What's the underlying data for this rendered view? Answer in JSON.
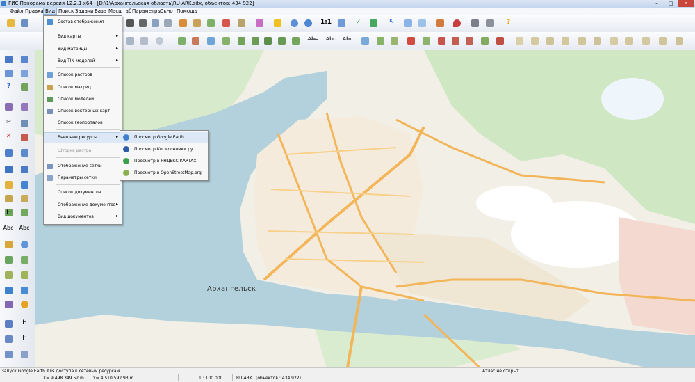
{
  "window": {
    "title": "ГИС Панорама версия 12.2.1 x64 - [D:\\1\\Архангельская область\\RU-ARK.sitx, объектов: 434 922]",
    "controls": [
      "–",
      "□",
      "✕"
    ]
  },
  "menubar": {
    "items": [
      "Файл",
      "Правка",
      "Вид",
      "Поиск",
      "Задачи",
      "База",
      "Масштаб",
      "Параметры",
      "Окно",
      "Помощь"
    ]
  },
  "toolbar": {
    "scale_button": "1:1",
    "labels": [
      "Abc",
      "Abc",
      "Abc"
    ]
  },
  "left_toolbar": {
    "labels": [
      "Abc",
      "Abc",
      "H",
      "H",
      "H"
    ]
  },
  "view_menu": {
    "items": [
      {
        "label": "Состав отображения",
        "arrow": "",
        "disabled": false
      },
      {
        "label": "Вид карты",
        "arrow": "▸",
        "disabled": false
      },
      {
        "label": "Вид матрицы",
        "arrow": "▸",
        "disabled": false
      },
      {
        "label": "Вид TIN-моделей",
        "arrow": "▸",
        "disabled": false
      },
      {
        "label": "Список растров",
        "arrow": "",
        "disabled": false
      },
      {
        "label": "Список матриц",
        "arrow": "",
        "disabled": false
      },
      {
        "label": "Список моделей",
        "arrow": "",
        "disabled": false
      },
      {
        "label": "Список векторных карт",
        "arrow": "",
        "disabled": false
      },
      {
        "label": "Список геопорталов",
        "arrow": "",
        "disabled": false
      },
      {
        "label": "Внешние ресурсы",
        "arrow": "▸",
        "disabled": false
      },
      {
        "label": "Шторка растра",
        "arrow": "",
        "disabled": true
      },
      {
        "label": "Отображение сетки",
        "arrow": "",
        "disabled": false
      },
      {
        "label": "Параметры сетки",
        "arrow": "",
        "disabled": false
      },
      {
        "label": "Список документов",
        "arrow": "",
        "disabled": false
      },
      {
        "label": "Отображение документов",
        "arrow": "▸",
        "disabled": false
      },
      {
        "label": "Вид документов",
        "arrow": "▸",
        "disabled": false
      }
    ]
  },
  "external_resources_submenu": {
    "items": [
      {
        "label": "Просмотр Google Earth"
      },
      {
        "label": "Просмотр Космоснимки.ру"
      },
      {
        "label": "Просмотр в ЯНДЕКС.КАРТАХ"
      },
      {
        "label": "Просмотр в OpenStreetMap.org"
      }
    ]
  },
  "map": {
    "city_label": "Архангельск"
  },
  "status": {
    "message": "Запуск Google Earth для доступа к сетевым ресурсам",
    "atlas": "Атлас не открыт",
    "x": "X= 9 498 349.52 m",
    "y": "Y= 4 510 592.93 m",
    "scale": "1 : 100 000",
    "map_name": "RU-ARK",
    "objects": "(объектов : 434 922)"
  },
  "colors": {
    "water": "#b3d1dc",
    "land": "#f1efe6",
    "forest": "#cfe7c2",
    "roads": "#f2b559",
    "menu_highlight": "#dde8f6"
  }
}
